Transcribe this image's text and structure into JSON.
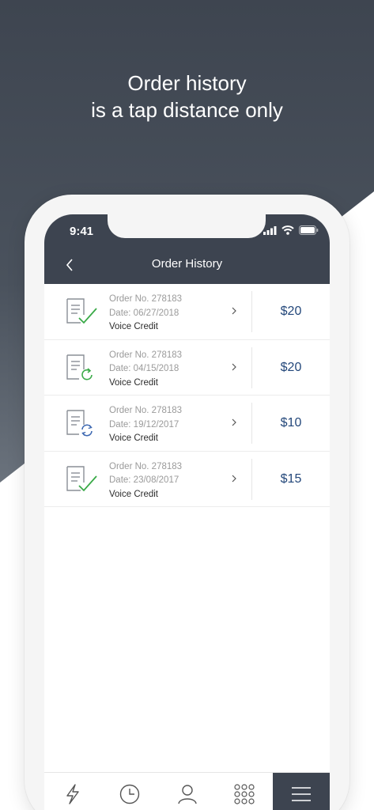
{
  "headline": {
    "line1": "Order history",
    "line2": "is a tap distance only"
  },
  "status_bar": {
    "time": "9:41",
    "icons": [
      "signal-icon",
      "wifi-icon",
      "battery-icon"
    ]
  },
  "nav": {
    "title": "Order History",
    "back_icon": "chevron-left-icon"
  },
  "orders": [
    {
      "order_no": "Order No. 278183",
      "date": "Date: 06/27/2018",
      "type": "Voice Credit",
      "amount": "$20",
      "status_icon": "document-check-icon"
    },
    {
      "order_no": "Order No. 278183",
      "date": "Date: 04/15/2018",
      "type": "Voice Credit",
      "amount": "$20",
      "status_icon": "document-refresh-icon"
    },
    {
      "order_no": "Order No. 278183",
      "date": "Date: 19/12/2017",
      "type": "Voice Credit",
      "amount": "$10",
      "status_icon": "document-sync-icon"
    },
    {
      "order_no": "Order No. 278183",
      "date": "Date: 23/08/2017",
      "type": "Voice Credit",
      "amount": "$15",
      "status_icon": "document-check-icon"
    }
  ],
  "tabs": [
    {
      "icon": "lightning-icon",
      "active": false
    },
    {
      "icon": "clock-icon",
      "active": false
    },
    {
      "icon": "user-icon",
      "active": false
    },
    {
      "icon": "dialpad-icon",
      "active": false
    },
    {
      "icon": "menu-icon",
      "active": true
    }
  ],
  "colors": {
    "header_bg": "#3d4450",
    "amount_text": "#23477a",
    "status_green": "#3aaa48",
    "status_blue": "#3a66b0",
    "background_dark": "#3e4550"
  }
}
